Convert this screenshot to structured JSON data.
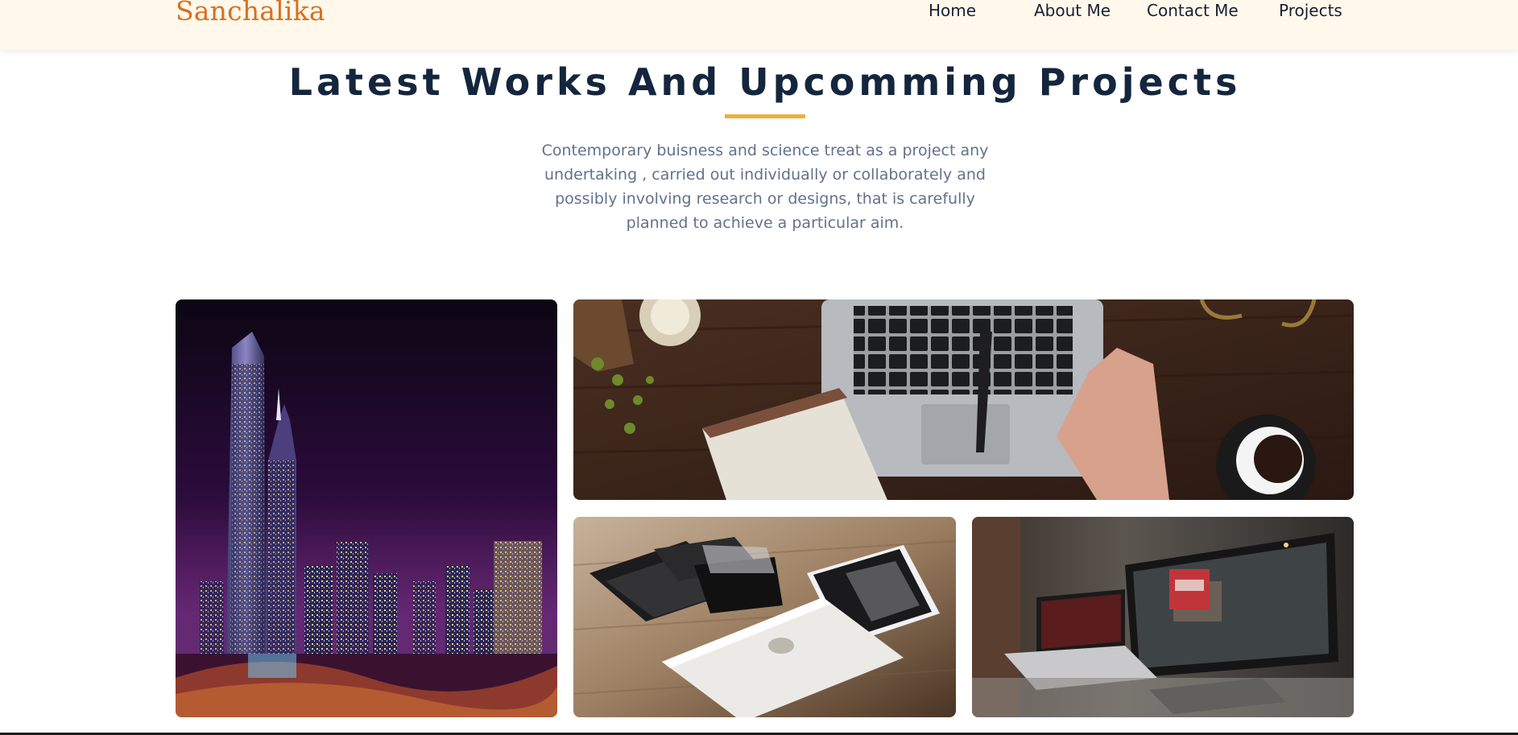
{
  "nav": {
    "brand": "Sanchalika",
    "links": [
      "Home",
      "About Me",
      "Contact Me",
      "Projects"
    ]
  },
  "section": {
    "title": "Latest Works And Upcomming Projects",
    "description": "Contemporary buisness and science treat as a project any undertaking , carried out individually or collaborately and possibly involving research or designs, that is carefully planned to achieve a particular aim.",
    "accent_color": "#ebb13c"
  },
  "gallery": {
    "items": [
      {
        "label": "city-night-skyline-image"
      },
      {
        "label": "laptop-desk-hand-image"
      },
      {
        "label": "devices-on-table-image"
      },
      {
        "label": "workspace-monitor-laptop-image"
      }
    ]
  },
  "colors": {
    "brand": "#d9701f",
    "navbar_bg": "#fff8eb",
    "title": "#14263d",
    "body_text": "#62728a"
  }
}
